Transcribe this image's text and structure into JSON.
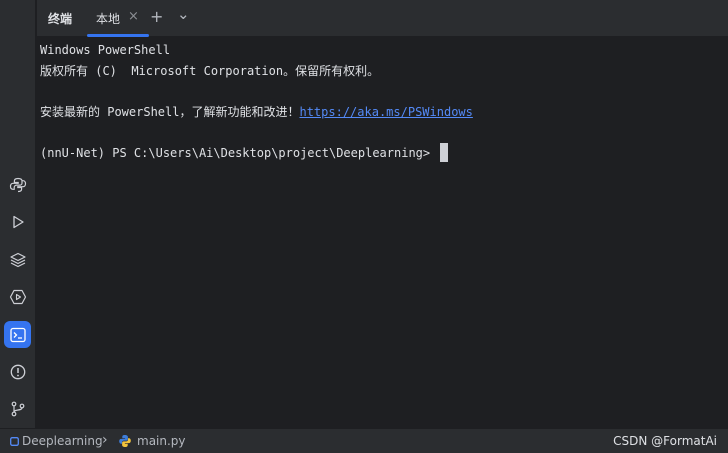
{
  "tool_window": {
    "title": "终端",
    "tab": {
      "label": "本地",
      "close": "×"
    },
    "add_tab": "+",
    "dropdown": "⌄"
  },
  "terminal": {
    "lines": [
      "Windows PowerShell",
      "版权所有 (C)  Microsoft Corporation。保留所有权利。",
      "",
      "安装最新的 PowerShell，了解新功能和改进！",
      "",
      "(nnU-Net) PS C:\\Users\\Ai\\Desktop\\project\\Deeplearning> "
    ],
    "link": "https://aka.ms/PSWindows"
  },
  "left_toolbar": {
    "icons": [
      "python-console-icon",
      "run-icon",
      "layers-icon",
      "services-icon",
      "terminal-icon",
      "problems-icon",
      "git-icon"
    ],
    "active": "terminal-icon",
    "accent": "#3574f0"
  },
  "status_bar": {
    "breadcrumb": [
      "Deeplearning",
      "main.py"
    ],
    "separator": "›",
    "watermark": "CSDN @FormatAi"
  }
}
